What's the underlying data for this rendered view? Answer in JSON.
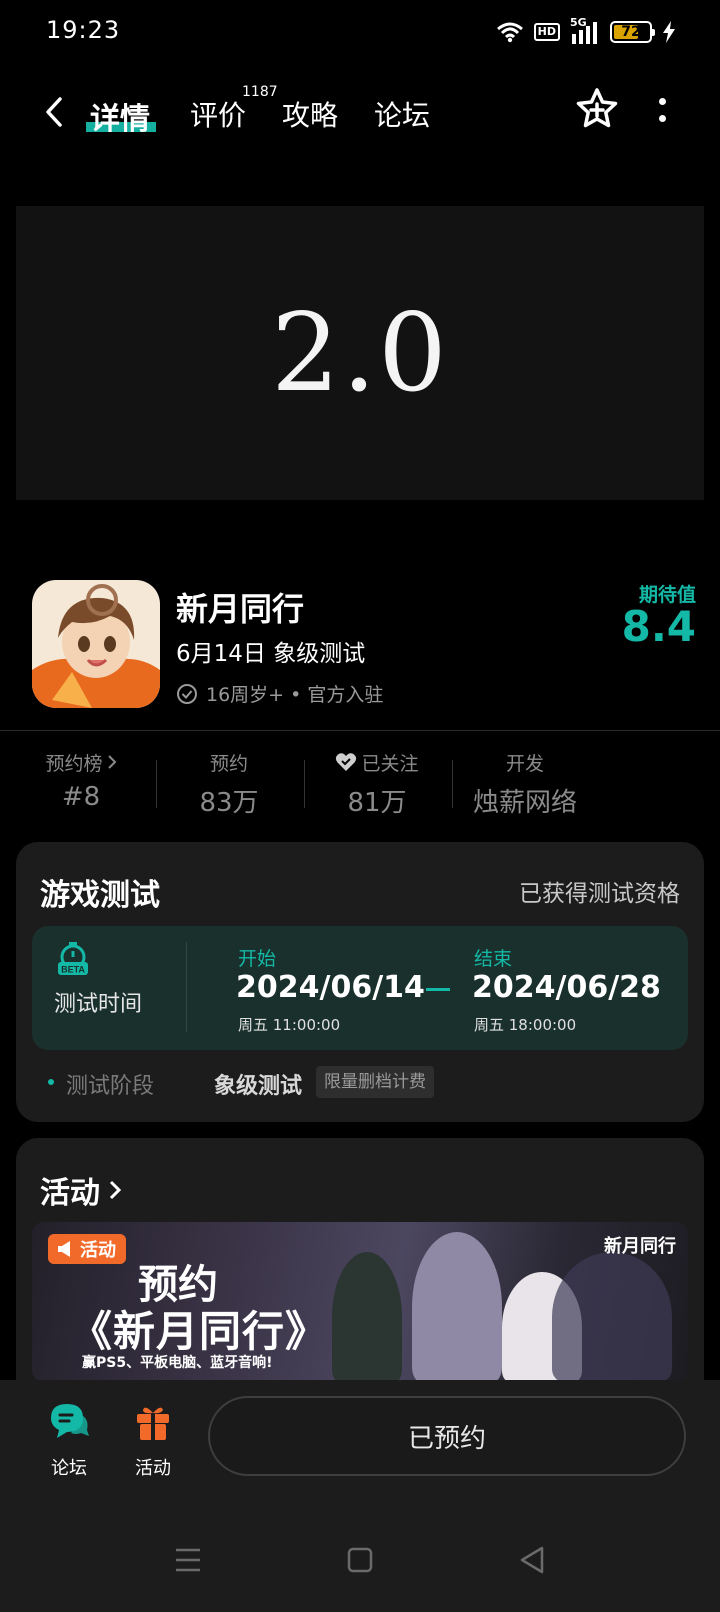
{
  "status_bar": {
    "time": "19:23",
    "hd": "HD",
    "network": "5G",
    "battery": "72",
    "battery_level": 0.72
  },
  "nav": {
    "tabs": [
      {
        "label": "详情",
        "active": true
      },
      {
        "label": "评价",
        "badge": "1187"
      },
      {
        "label": "攻略"
      },
      {
        "label": "论坛"
      }
    ]
  },
  "hero": {
    "text": "2.0"
  },
  "game": {
    "name": "新月同行",
    "subtitle": "6月14日 象级测试",
    "meta": "16周岁+ • 官方入驻",
    "expect_label": "期待值",
    "expect_value": "8.4"
  },
  "stats": [
    {
      "label": "预约榜",
      "value": "#8"
    },
    {
      "label": "预约",
      "value": "83万"
    },
    {
      "label": "已关注",
      "value": "81万"
    },
    {
      "label": "开发",
      "value": "烛薪网络"
    }
  ],
  "test_card": {
    "title": "游戏测试",
    "status": "已获得测试资格",
    "icon_label": "BETA",
    "time_label": "测试时间",
    "start_label": "开始",
    "start_date": "2024/06/14",
    "start_time": "周五  11:00:00",
    "end_label": "结束",
    "end_date": "2024/06/28",
    "end_time": "周五  18:00:00",
    "stage_label": "测试阶段",
    "stage_value": "象级测试",
    "stage_tag": "限量删档计费"
  },
  "activity_card": {
    "title": "活动",
    "banner": {
      "tag": "活动",
      "brand": "新月同行",
      "line1": "预约",
      "line2": "《新月同行》",
      "line3": "赢PS5、平板电脑、蓝牙音响!"
    }
  },
  "bottom_bar": {
    "forum_label": "论坛",
    "activity_label": "活动",
    "reserve_label": "已预约"
  },
  "colors": {
    "accent": "#14b8a6",
    "orange": "#f26a2a",
    "card_bg": "#1c1c1c"
  }
}
